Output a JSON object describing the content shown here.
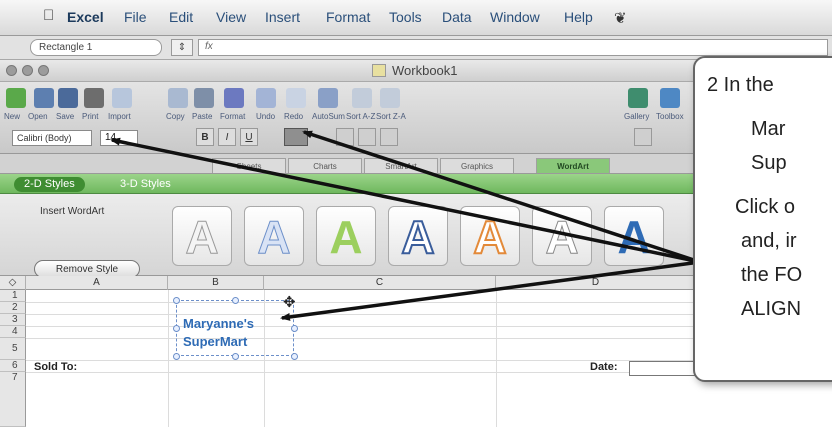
{
  "menubar": {
    "items": [
      "Excel",
      "File",
      "Edit",
      "View",
      "Insert",
      "Format",
      "Tools",
      "Data",
      "Window",
      "Help"
    ],
    "apple_icon": "apple-icon",
    "script_icon": "script-icon"
  },
  "formula_bar": {
    "name_box": "Rectangle 1",
    "fx_label": "fx"
  },
  "window": {
    "title": "Workbook1"
  },
  "toolbar": {
    "labels": [
      "New",
      "Open",
      "Save",
      "Print",
      "Import",
      "Copy",
      "Paste",
      "Format",
      "Undo",
      "Redo",
      "AutoSum",
      "Sort A-Z",
      "Sort Z-A",
      "Gallery",
      "Toolbox"
    ],
    "font_name": "Calibri (Body)",
    "font_size": "14",
    "bold": "B",
    "italic": "I",
    "underline": "U"
  },
  "ribbon": {
    "tabs": [
      "Sheets",
      "Charts",
      "SmartArt",
      "Graphics",
      "WordArt"
    ],
    "active_tab": "WordArt",
    "subtabs": [
      "2-D Styles",
      "3-D Styles"
    ],
    "insert_label": "Insert WordArt",
    "remove_style": "Remove Style",
    "style_samples": [
      "A",
      "A",
      "A",
      "A",
      "A",
      "A",
      "A"
    ]
  },
  "sheet": {
    "columns": [
      "A",
      "B",
      "C",
      "D"
    ],
    "rows": [
      "1",
      "2",
      "3",
      "4",
      "5",
      "6",
      "7"
    ],
    "sold_to": "Sold To:",
    "date_label": "Date:",
    "wordart_line1": "Maryanne's",
    "wordart_line2": "SuperMart"
  },
  "callout": {
    "line1": "2  In the",
    "line2": "Mar",
    "line3": "Sup",
    "line4": "Click o",
    "line5": "and, ir",
    "line6": "the FO",
    "line7": "ALIGN"
  },
  "colors": {
    "accent_green": "#6fb85e",
    "wordart_blue": "#2e6bb5",
    "menu_blue": "#2a4f7a"
  }
}
